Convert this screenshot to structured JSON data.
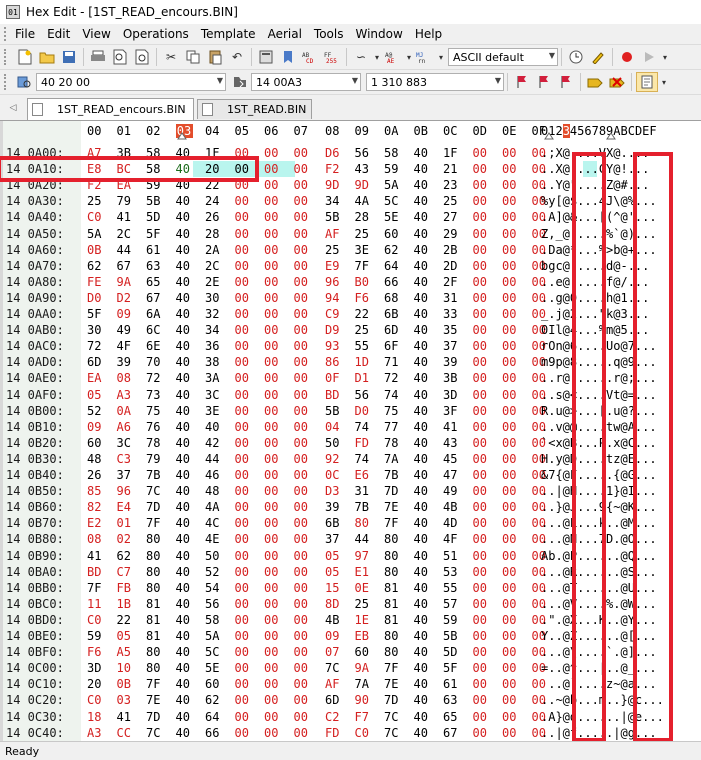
{
  "window": {
    "title": "Hex Edit - [1ST_READ_encours.BIN]"
  },
  "menu": [
    "File",
    "Edit",
    "View",
    "Operations",
    "Template",
    "Aerial",
    "Tools",
    "Window",
    "Help"
  ],
  "toolbar": {
    "charset": "ASCII default",
    "search_hex": "40 20 00",
    "jump_address": "14 00A3",
    "jump_decimal": "1 310 883"
  },
  "tabs": [
    "1ST_READ_encours.BIN",
    "1ST_READ.BIN"
  ],
  "status": "Ready",
  "colors": {
    "highlight_col": "#e34d2b",
    "red_box": "#e4202d",
    "cursor_fill": "#b9f5ee"
  },
  "hex_header": [
    "00",
    "01",
    "02",
    "03",
    "04",
    "05",
    "06",
    "07",
    "08",
    "09",
    "0A",
    "0B",
    "0C",
    "0D",
    "0E",
    "0F"
  ],
  "ascii_header": "0123456789ABCDEF",
  "rows": [
    {
      "addr": "14 0A00:",
      "bytes": [
        "A7",
        "3B",
        "58",
        "40",
        "1F",
        "00",
        "00",
        "00",
        "D6",
        "56",
        "58",
        "40",
        "1F",
        "00",
        "00",
        "00"
      ],
      "ascii": ".;X@....VX@...."
    },
    {
      "addr": "14 0A10:",
      "bytes": [
        "E8",
        "BC",
        "58",
        "40",
        "20",
        "00",
        "00",
        "00",
        "F2",
        "43",
        "59",
        "40",
        "21",
        "00",
        "00",
        "00"
      ],
      "ascii": "..X@ ...CY@!..."
    },
    {
      "addr": "14 0A20:",
      "bytes": [
        "F2",
        "EA",
        "59",
        "40",
        "22",
        "00",
        "00",
        "00",
        "9D",
        "9D",
        "5A",
        "40",
        "23",
        "00",
        "00",
        "00"
      ],
      "ascii": "..Y@\"....Z@#..."
    },
    {
      "addr": "14 0A30:",
      "bytes": [
        "25",
        "79",
        "5B",
        "40",
        "24",
        "00",
        "00",
        "00",
        "34",
        "4A",
        "5C",
        "40",
        "25",
        "00",
        "00",
        "00"
      ],
      "ascii": "%y[@$...4J\\@%..."
    },
    {
      "addr": "14 0A40:",
      "bytes": [
        "C0",
        "41",
        "5D",
        "40",
        "26",
        "00",
        "00",
        "00",
        "5B",
        "28",
        "5E",
        "40",
        "27",
        "00",
        "00",
        "00"
      ],
      "ascii": ".A]@&...[(^@'..."
    },
    {
      "addr": "14 0A50:",
      "bytes": [
        "5A",
        "2C",
        "5F",
        "40",
        "28",
        "00",
        "00",
        "00",
        "AF",
        "25",
        "60",
        "40",
        "29",
        "00",
        "00",
        "00"
      ],
      "ascii": "Z,_@(....%`@)..."
    },
    {
      "addr": "14 0A60:",
      "bytes": [
        "0B",
        "44",
        "61",
        "40",
        "2A",
        "00",
        "00",
        "00",
        "25",
        "3E",
        "62",
        "40",
        "2B",
        "00",
        "00",
        "00"
      ],
      "ascii": ".Da@*...%>b@+..."
    },
    {
      "addr": "14 0A70:",
      "bytes": [
        "62",
        "67",
        "63",
        "40",
        "2C",
        "00",
        "00",
        "00",
        "E9",
        "7F",
        "64",
        "40",
        "2D",
        "00",
        "00",
        "00"
      ],
      "ascii": "bgc@,....d@-..."
    },
    {
      "addr": "14 0A80:",
      "bytes": [
        "FE",
        "9A",
        "65",
        "40",
        "2E",
        "00",
        "00",
        "00",
        "96",
        "B0",
        "66",
        "40",
        "2F",
        "00",
        "00",
        "00"
      ],
      "ascii": "..e@.....f@/..."
    },
    {
      "addr": "14 0A90:",
      "bytes": [
        "D0",
        "D2",
        "67",
        "40",
        "30",
        "00",
        "00",
        "00",
        "94",
        "F6",
        "68",
        "40",
        "31",
        "00",
        "00",
        "00"
      ],
      "ascii": "..g@0....h@1..."
    },
    {
      "addr": "14 0AA0:",
      "bytes": [
        "5F",
        "09",
        "6A",
        "40",
        "32",
        "00",
        "00",
        "00",
        "C9",
        "22",
        "6B",
        "40",
        "33",
        "00",
        "00",
        "00"
      ],
      "ascii": "_.j@2...\"k@3..."
    },
    {
      "addr": "14 0AB0:",
      "bytes": [
        "30",
        "49",
        "6C",
        "40",
        "34",
        "00",
        "00",
        "00",
        "D9",
        "25",
        "6D",
        "40",
        "35",
        "00",
        "00",
        "00"
      ],
      "ascii": "0Il@4...%m@5..."
    },
    {
      "addr": "14 0AC0:",
      "bytes": [
        "72",
        "4F",
        "6E",
        "40",
        "36",
        "00",
        "00",
        "00",
        "93",
        "55",
        "6F",
        "40",
        "37",
        "00",
        "00",
        "00"
      ],
      "ascii": "rOn@6....Uo@7..."
    },
    {
      "addr": "14 0AD0:",
      "bytes": [
        "6D",
        "39",
        "70",
        "40",
        "38",
        "00",
        "00",
        "00",
        "86",
        "1D",
        "71",
        "40",
        "39",
        "00",
        "00",
        "00"
      ],
      "ascii": "m9p@8.....q@9..."
    },
    {
      "addr": "14 0AE0:",
      "bytes": [
        "EA",
        "08",
        "72",
        "40",
        "3A",
        "00",
        "00",
        "00",
        "0F",
        "D1",
        "72",
        "40",
        "3B",
        "00",
        "00",
        "00"
      ],
      "ascii": "..r@:.....r@;..."
    },
    {
      "addr": "14 0AF0:",
      "bytes": [
        "05",
        "A3",
        "73",
        "40",
        "3C",
        "00",
        "00",
        "00",
        "BD",
        "56",
        "74",
        "40",
        "3D",
        "00",
        "00",
        "00"
      ],
      "ascii": "..s@<....Vt@=..."
    },
    {
      "addr": "14 0B00:",
      "bytes": [
        "52",
        "0A",
        "75",
        "40",
        "3E",
        "00",
        "00",
        "00",
        "5B",
        "D0",
        "75",
        "40",
        "3F",
        "00",
        "00",
        "00"
      ],
      "ascii": "R.u@>...[.u@?..."
    },
    {
      "addr": "14 0B10:",
      "bytes": [
        "09",
        "A6",
        "76",
        "40",
        "40",
        "00",
        "00",
        "00",
        "04",
        "74",
        "77",
        "40",
        "41",
        "00",
        "00",
        "00"
      ],
      "ascii": "..v@@....tw@A..."
    },
    {
      "addr": "14 0B20:",
      "bytes": [
        "60",
        "3C",
        "78",
        "40",
        "42",
        "00",
        "00",
        "00",
        "50",
        "FD",
        "78",
        "40",
        "43",
        "00",
        "00",
        "00"
      ],
      "ascii": "`<x@B...P.x@C..."
    },
    {
      "addr": "14 0B30:",
      "bytes": [
        "48",
        "C3",
        "79",
        "40",
        "44",
        "00",
        "00",
        "00",
        "92",
        "74",
        "7A",
        "40",
        "45",
        "00",
        "00",
        "00"
      ],
      "ascii": "H.y@D....tz@E..."
    },
    {
      "addr": "14 0B40:",
      "bytes": [
        "26",
        "37",
        "7B",
        "40",
        "46",
        "00",
        "00",
        "00",
        "0C",
        "E6",
        "7B",
        "40",
        "47",
        "00",
        "00",
        "00"
      ],
      "ascii": "&7{@F.....{@G..."
    },
    {
      "addr": "14 0B50:",
      "bytes": [
        "85",
        "96",
        "7C",
        "40",
        "48",
        "00",
        "00",
        "00",
        "D3",
        "31",
        "7D",
        "40",
        "49",
        "00",
        "00",
        "00"
      ],
      "ascii": "..|@H....1}@I..."
    },
    {
      "addr": "14 0B60:",
      "bytes": [
        "82",
        "E4",
        "7D",
        "40",
        "4A",
        "00",
        "00",
        "00",
        "39",
        "7B",
        "7E",
        "40",
        "4B",
        "00",
        "00",
        "00"
      ],
      "ascii": "..}@J...9{~@K..."
    },
    {
      "addr": "14 0B70:",
      "bytes": [
        "E2",
        "01",
        "7F",
        "40",
        "4C",
        "00",
        "00",
        "00",
        "6B",
        "80",
        "7F",
        "40",
        "4D",
        "00",
        "00",
        "00"
      ],
      "ascii": "...@L...k..@M..."
    },
    {
      "addr": "14 0B80:",
      "bytes": [
        "08",
        "02",
        "80",
        "40",
        "4E",
        "00",
        "00",
        "00",
        "37",
        "44",
        "80",
        "40",
        "4F",
        "00",
        "00",
        "00"
      ],
      "ascii": "...@N...7D.@O..."
    },
    {
      "addr": "14 0B90:",
      "bytes": [
        "41",
        "62",
        "80",
        "40",
        "50",
        "00",
        "00",
        "00",
        "05",
        "97",
        "80",
        "40",
        "51",
        "00",
        "00",
        "00"
      ],
      "ascii": "Ab.@P......@Q..."
    },
    {
      "addr": "14 0BA0:",
      "bytes": [
        "BD",
        "C7",
        "80",
        "40",
        "52",
        "00",
        "00",
        "00",
        "05",
        "E1",
        "80",
        "40",
        "53",
        "00",
        "00",
        "00"
      ],
      "ascii": "...@R......@S..."
    },
    {
      "addr": "14 0BB0:",
      "bytes": [
        "7F",
        "FB",
        "80",
        "40",
        "54",
        "00",
        "00",
        "00",
        "15",
        "0E",
        "81",
        "40",
        "55",
        "00",
        "00",
        "00"
      ],
      "ascii": "...@T......@U..."
    },
    {
      "addr": "14 0BC0:",
      "bytes": [
        "11",
        "1B",
        "81",
        "40",
        "56",
        "00",
        "00",
        "00",
        "8D",
        "25",
        "81",
        "40",
        "57",
        "00",
        "00",
        "00"
      ],
      "ascii": "...@V....%.@W..."
    },
    {
      "addr": "14 0BD0:",
      "bytes": [
        "C0",
        "22",
        "81",
        "40",
        "58",
        "00",
        "00",
        "00",
        "4B",
        "1E",
        "81",
        "40",
        "59",
        "00",
        "00",
        "00"
      ],
      "ascii": ".\".@X...K..@Y..."
    },
    {
      "addr": "14 0BE0:",
      "bytes": [
        "59",
        "05",
        "81",
        "40",
        "5A",
        "00",
        "00",
        "00",
        "09",
        "EB",
        "80",
        "40",
        "5B",
        "00",
        "00",
        "00"
      ],
      "ascii": "Y..@Z......@[..."
    },
    {
      "addr": "14 0BF0:",
      "bytes": [
        "F6",
        "A5",
        "80",
        "40",
        "5C",
        "00",
        "00",
        "00",
        "07",
        "60",
        "80",
        "40",
        "5D",
        "00",
        "00",
        "00"
      ],
      "ascii": "...@\\....`.@]..."
    },
    {
      "addr": "14 0C00:",
      "bytes": [
        "3D",
        "10",
        "80",
        "40",
        "5E",
        "00",
        "00",
        "00",
        "7C",
        "9A",
        "7F",
        "40",
        "5F",
        "00",
        "00",
        "00"
      ],
      "ascii": "=..@^...|..@_..."
    },
    {
      "addr": "14 0C10:",
      "bytes": [
        "20",
        "0B",
        "7F",
        "40",
        "60",
        "00",
        "00",
        "00",
        "AF",
        "7A",
        "7E",
        "40",
        "61",
        "00",
        "00",
        "00"
      ],
      "ascii": " ..@`....z~@a..."
    },
    {
      "addr": "14 0C20:",
      "bytes": [
        "C0",
        "03",
        "7E",
        "40",
        "62",
        "00",
        "00",
        "00",
        "6D",
        "90",
        "7D",
        "40",
        "63",
        "00",
        "00",
        "00"
      ],
      "ascii": "..~@b...m..}@c..."
    },
    {
      "addr": "14 0C30:",
      "bytes": [
        "18",
        "41",
        "7D",
        "40",
        "64",
        "00",
        "00",
        "00",
        "C2",
        "F7",
        "7C",
        "40",
        "65",
        "00",
        "00",
        "00"
      ],
      "ascii": ".A}@d......|@e..."
    },
    {
      "addr": "14 0C40:",
      "bytes": [
        "A3",
        "CC",
        "7C",
        "40",
        "66",
        "00",
        "00",
        "00",
        "FD",
        "C0",
        "7C",
        "40",
        "67",
        "00",
        "00",
        "00"
      ],
      "ascii": "..|@f.....|@g..."
    }
  ]
}
